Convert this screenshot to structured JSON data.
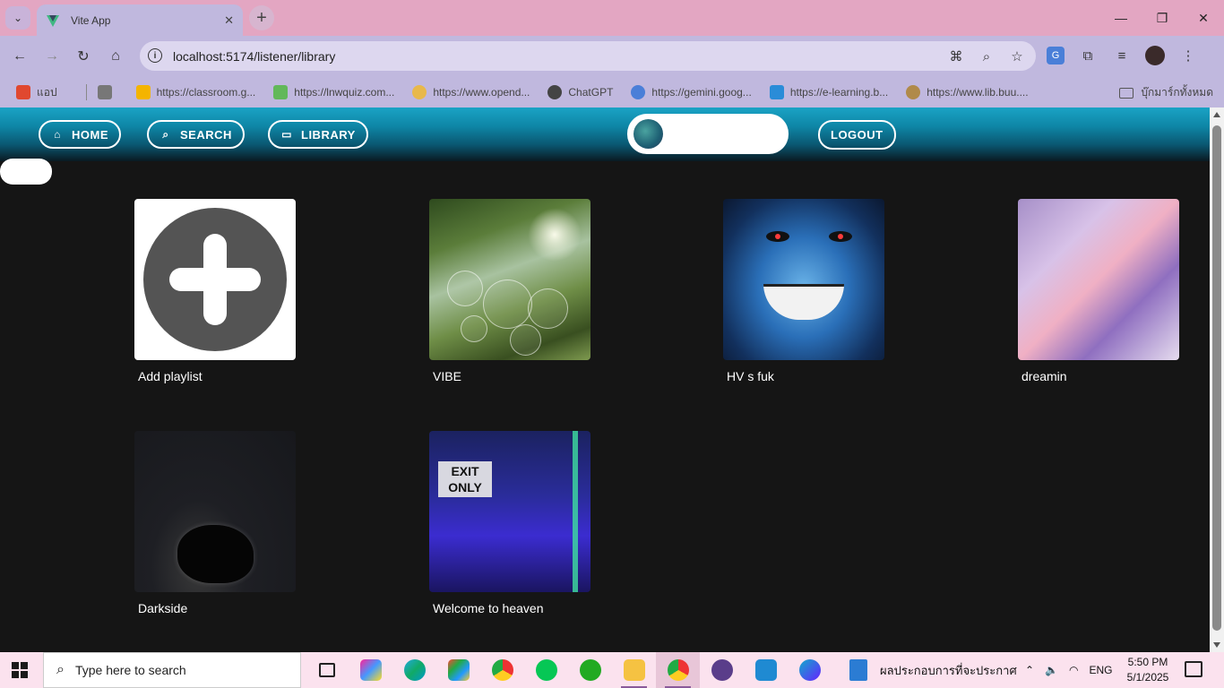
{
  "browser": {
    "tab_title": "Vite App",
    "tab_close": "✕",
    "new_tab": "+",
    "url": "localhost:5174/listener/library",
    "bookmarks": [
      {
        "label": "แอป",
        "color": "#e0482f"
      },
      {
        "label": "https://classroom.g...",
        "color": "#f4b400"
      },
      {
        "label": "https://lnwquiz.com...",
        "color": "#62b85a"
      },
      {
        "label": "https://www.opend...",
        "color": "#e8b84a"
      },
      {
        "label": "ChatGPT",
        "color": "#444444"
      },
      {
        "label": "https://gemini.goog...",
        "color": "#4a7fd8"
      },
      {
        "label": "https://e-learning.b...",
        "color": "#2a8cd8"
      },
      {
        "label": "https://www.lib.buu....",
        "color": "#b08a4a"
      }
    ],
    "all_bookmarks": "บุ๊กมาร์กทั้งหมด"
  },
  "nav": {
    "home": "HOME",
    "search": "SEARCH",
    "library": "LIBRARY",
    "logout": "LOGOUT"
  },
  "library": {
    "items": [
      {
        "label": "Add playlist"
      },
      {
        "label": "VIBE"
      },
      {
        "label": "HV s fuk"
      },
      {
        "label": "dreamin"
      },
      {
        "label": "Darkside"
      },
      {
        "label": "Welcome to heaven"
      }
    ]
  },
  "taskbar": {
    "search_placeholder": "Type here to search",
    "doc_label": "ผลประกอบการที่จะประกาศ",
    "lang": "ENG",
    "time": "5:50 PM",
    "date": "5/1/2025"
  },
  "heaven_sign": "EXIT ONLY"
}
